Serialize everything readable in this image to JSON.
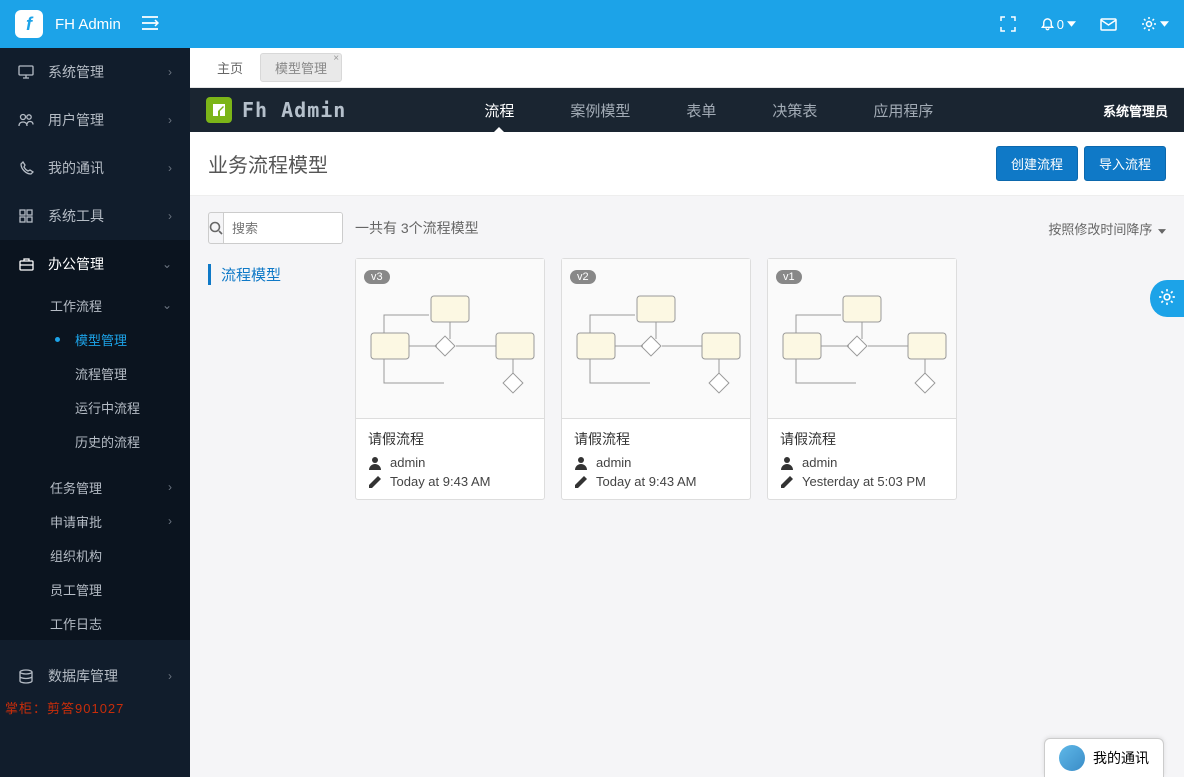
{
  "header": {
    "app_name": "FH Admin",
    "notif_count": "0"
  },
  "sidebar": {
    "items": [
      {
        "label": "系统管理"
      },
      {
        "label": "用户管理"
      },
      {
        "label": "我的通讯"
      },
      {
        "label": "系统工具"
      },
      {
        "label": "办公管理"
      },
      {
        "label": "数据库管理"
      }
    ],
    "office_sub": {
      "workflow": "工作流程",
      "workflow_children": [
        {
          "label": "模型管理",
          "active": true
        },
        {
          "label": "流程管理"
        },
        {
          "label": "运行中流程"
        },
        {
          "label": "历史的流程"
        }
      ],
      "others": [
        {
          "label": "任务管理",
          "arrow": true
        },
        {
          "label": "申请审批",
          "arrow": true
        },
        {
          "label": "组织机构"
        },
        {
          "label": "员工管理"
        },
        {
          "label": "工作日志"
        }
      ]
    }
  },
  "tabs": {
    "home": "主页",
    "active_tab": "模型管理"
  },
  "inner": {
    "brand": "Fh Admin",
    "nav": [
      "流程",
      "案例模型",
      "表单",
      "决策表",
      "应用程序"
    ],
    "user": "系统管理员"
  },
  "page": {
    "title": "业务流程模型",
    "create_btn": "创建流程",
    "import_btn": "导入流程"
  },
  "search": {
    "placeholder": "搜索"
  },
  "side_category": "流程模型",
  "count_text": "一共有 3个流程模型",
  "sort_label": "按照修改时间降序",
  "cards": [
    {
      "version": "v3",
      "title": "请假流程",
      "author": "admin",
      "time": "Today at 9:43 AM"
    },
    {
      "version": "v2",
      "title": "请假流程",
      "author": "admin",
      "time": "Today at 9:43 AM"
    },
    {
      "version": "v1",
      "title": "请假流程",
      "author": "admin",
      "time": "Yesterday at 5:03 PM"
    }
  ],
  "chat_label": "我的通讯",
  "watermark": "掌柜：剪答901027"
}
